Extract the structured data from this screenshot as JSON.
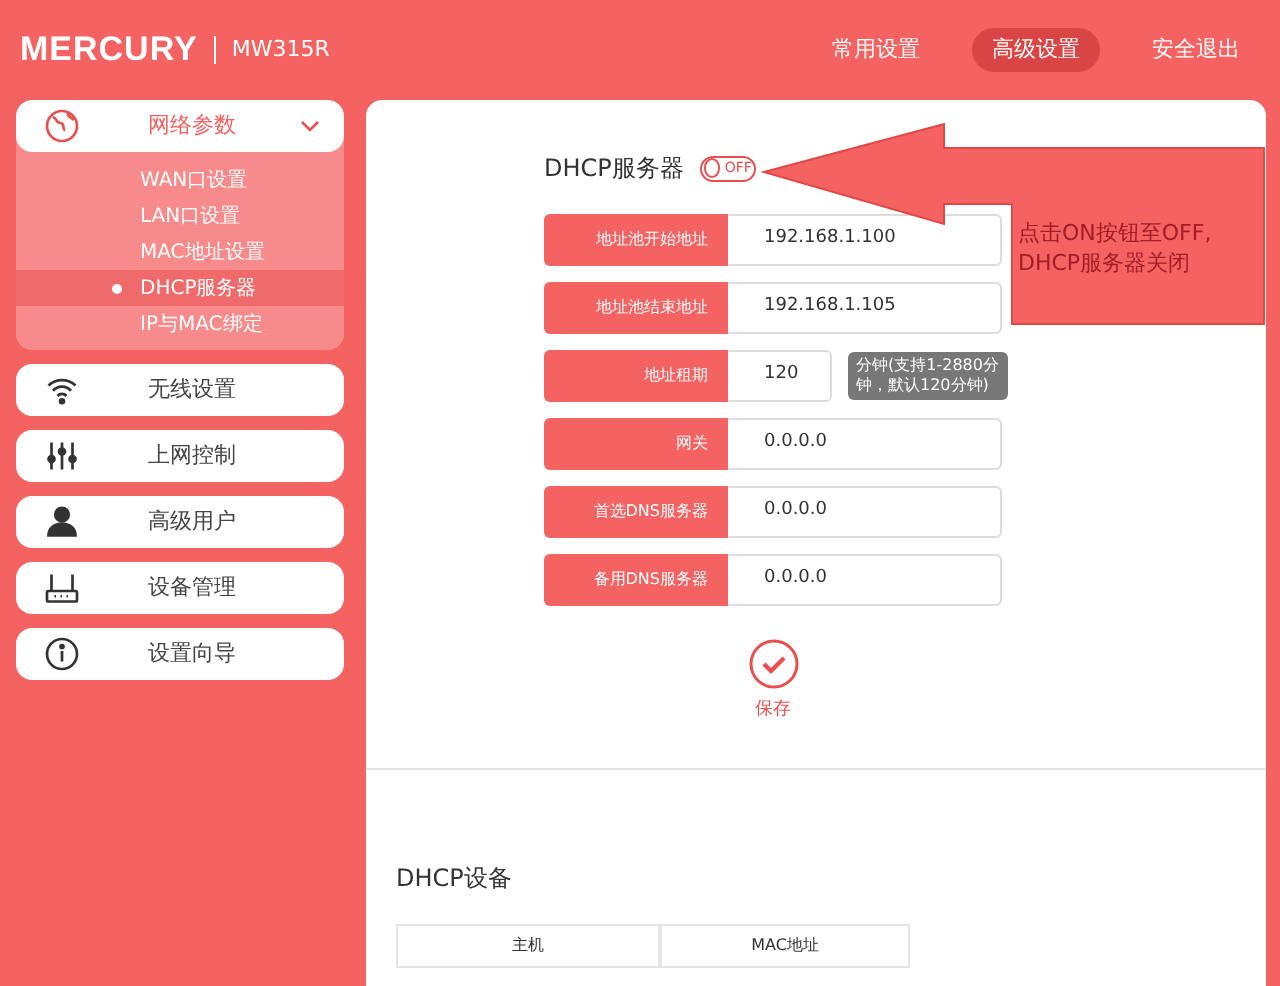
{
  "header": {
    "brand": "MERCURY",
    "model": "MW315R",
    "nav": [
      {
        "label": "常用设置",
        "selected": false
      },
      {
        "label": "高级设置",
        "selected": true
      },
      {
        "label": "安全退出",
        "selected": false
      }
    ]
  },
  "sidebar": {
    "groups": [
      {
        "label": "网络参数",
        "expanded": true,
        "children": [
          {
            "label": "WAN口设置",
            "selected": false
          },
          {
            "label": "LAN口设置",
            "selected": false
          },
          {
            "label": "MAC地址设置",
            "selected": false
          },
          {
            "label": "DHCP服务器",
            "selected": true
          },
          {
            "label": "IP与MAC绑定",
            "selected": false
          }
        ]
      },
      {
        "label": "无线设置"
      },
      {
        "label": "上网控制"
      },
      {
        "label": "高级用户"
      },
      {
        "label": "设备管理"
      },
      {
        "label": "设置向导"
      }
    ]
  },
  "dhcp_server": {
    "title": "DHCP服务器",
    "toggle": {
      "label": "OFF",
      "on": false
    },
    "fields": [
      {
        "label": "地址池开始地址",
        "value": "192.168.1.100"
      },
      {
        "label": "地址池结束地址",
        "value": "192.168.1.105"
      },
      {
        "label": "地址租期",
        "value": "120",
        "hint": "分钟(支持1-2880分钟，默认120分钟)"
      },
      {
        "label": "网关",
        "value": "0.0.0.0"
      },
      {
        "label": "首选DNS服务器",
        "value": "0.0.0.0"
      },
      {
        "label": "备用DNS服务器",
        "value": "0.0.0.0"
      }
    ],
    "save": "保存"
  },
  "annotation": {
    "text": "点击ON按钮至OFF,\nDHCP服务器关闭"
  },
  "dhcp_devices": {
    "title": "DHCP设备",
    "table": {
      "columns": [
        "主机",
        "MAC地址"
      ]
    }
  }
}
